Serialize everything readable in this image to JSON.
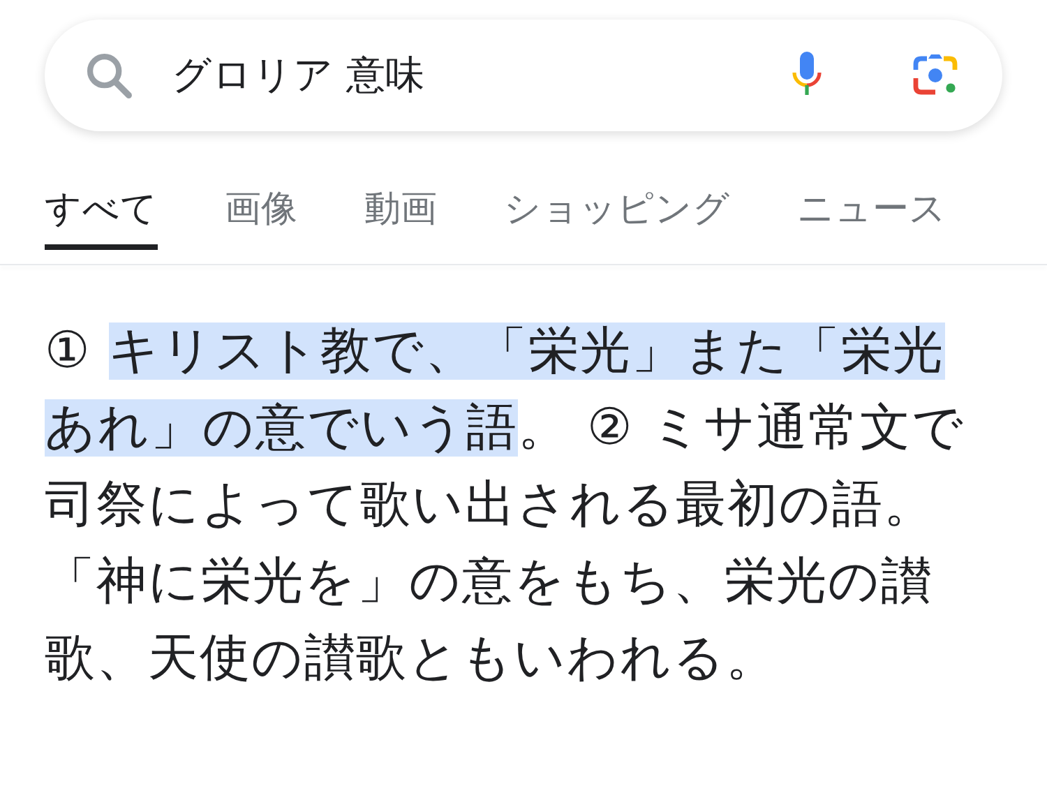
{
  "search": {
    "value": "グロリア 意味"
  },
  "tabs": [
    {
      "label": "すべて",
      "selected": true
    },
    {
      "label": "画像",
      "selected": false
    },
    {
      "label": "動画",
      "selected": false
    },
    {
      "label": "ショッピング",
      "selected": false
    },
    {
      "label": "ニュース",
      "selected": false
    }
  ],
  "definition": [
    {
      "text": "① ",
      "highlighted": false
    },
    {
      "text": "キリスト教で、「栄光」また「栄光あれ」の意でいう語",
      "highlighted": true
    },
    {
      "text": "。 ② ミサ通常文で司祭によって歌い出される最初の語。「神に栄光を」の意をもち、栄光の讃歌、天使の讃歌ともいわれる。",
      "highlighted": false
    }
  ]
}
